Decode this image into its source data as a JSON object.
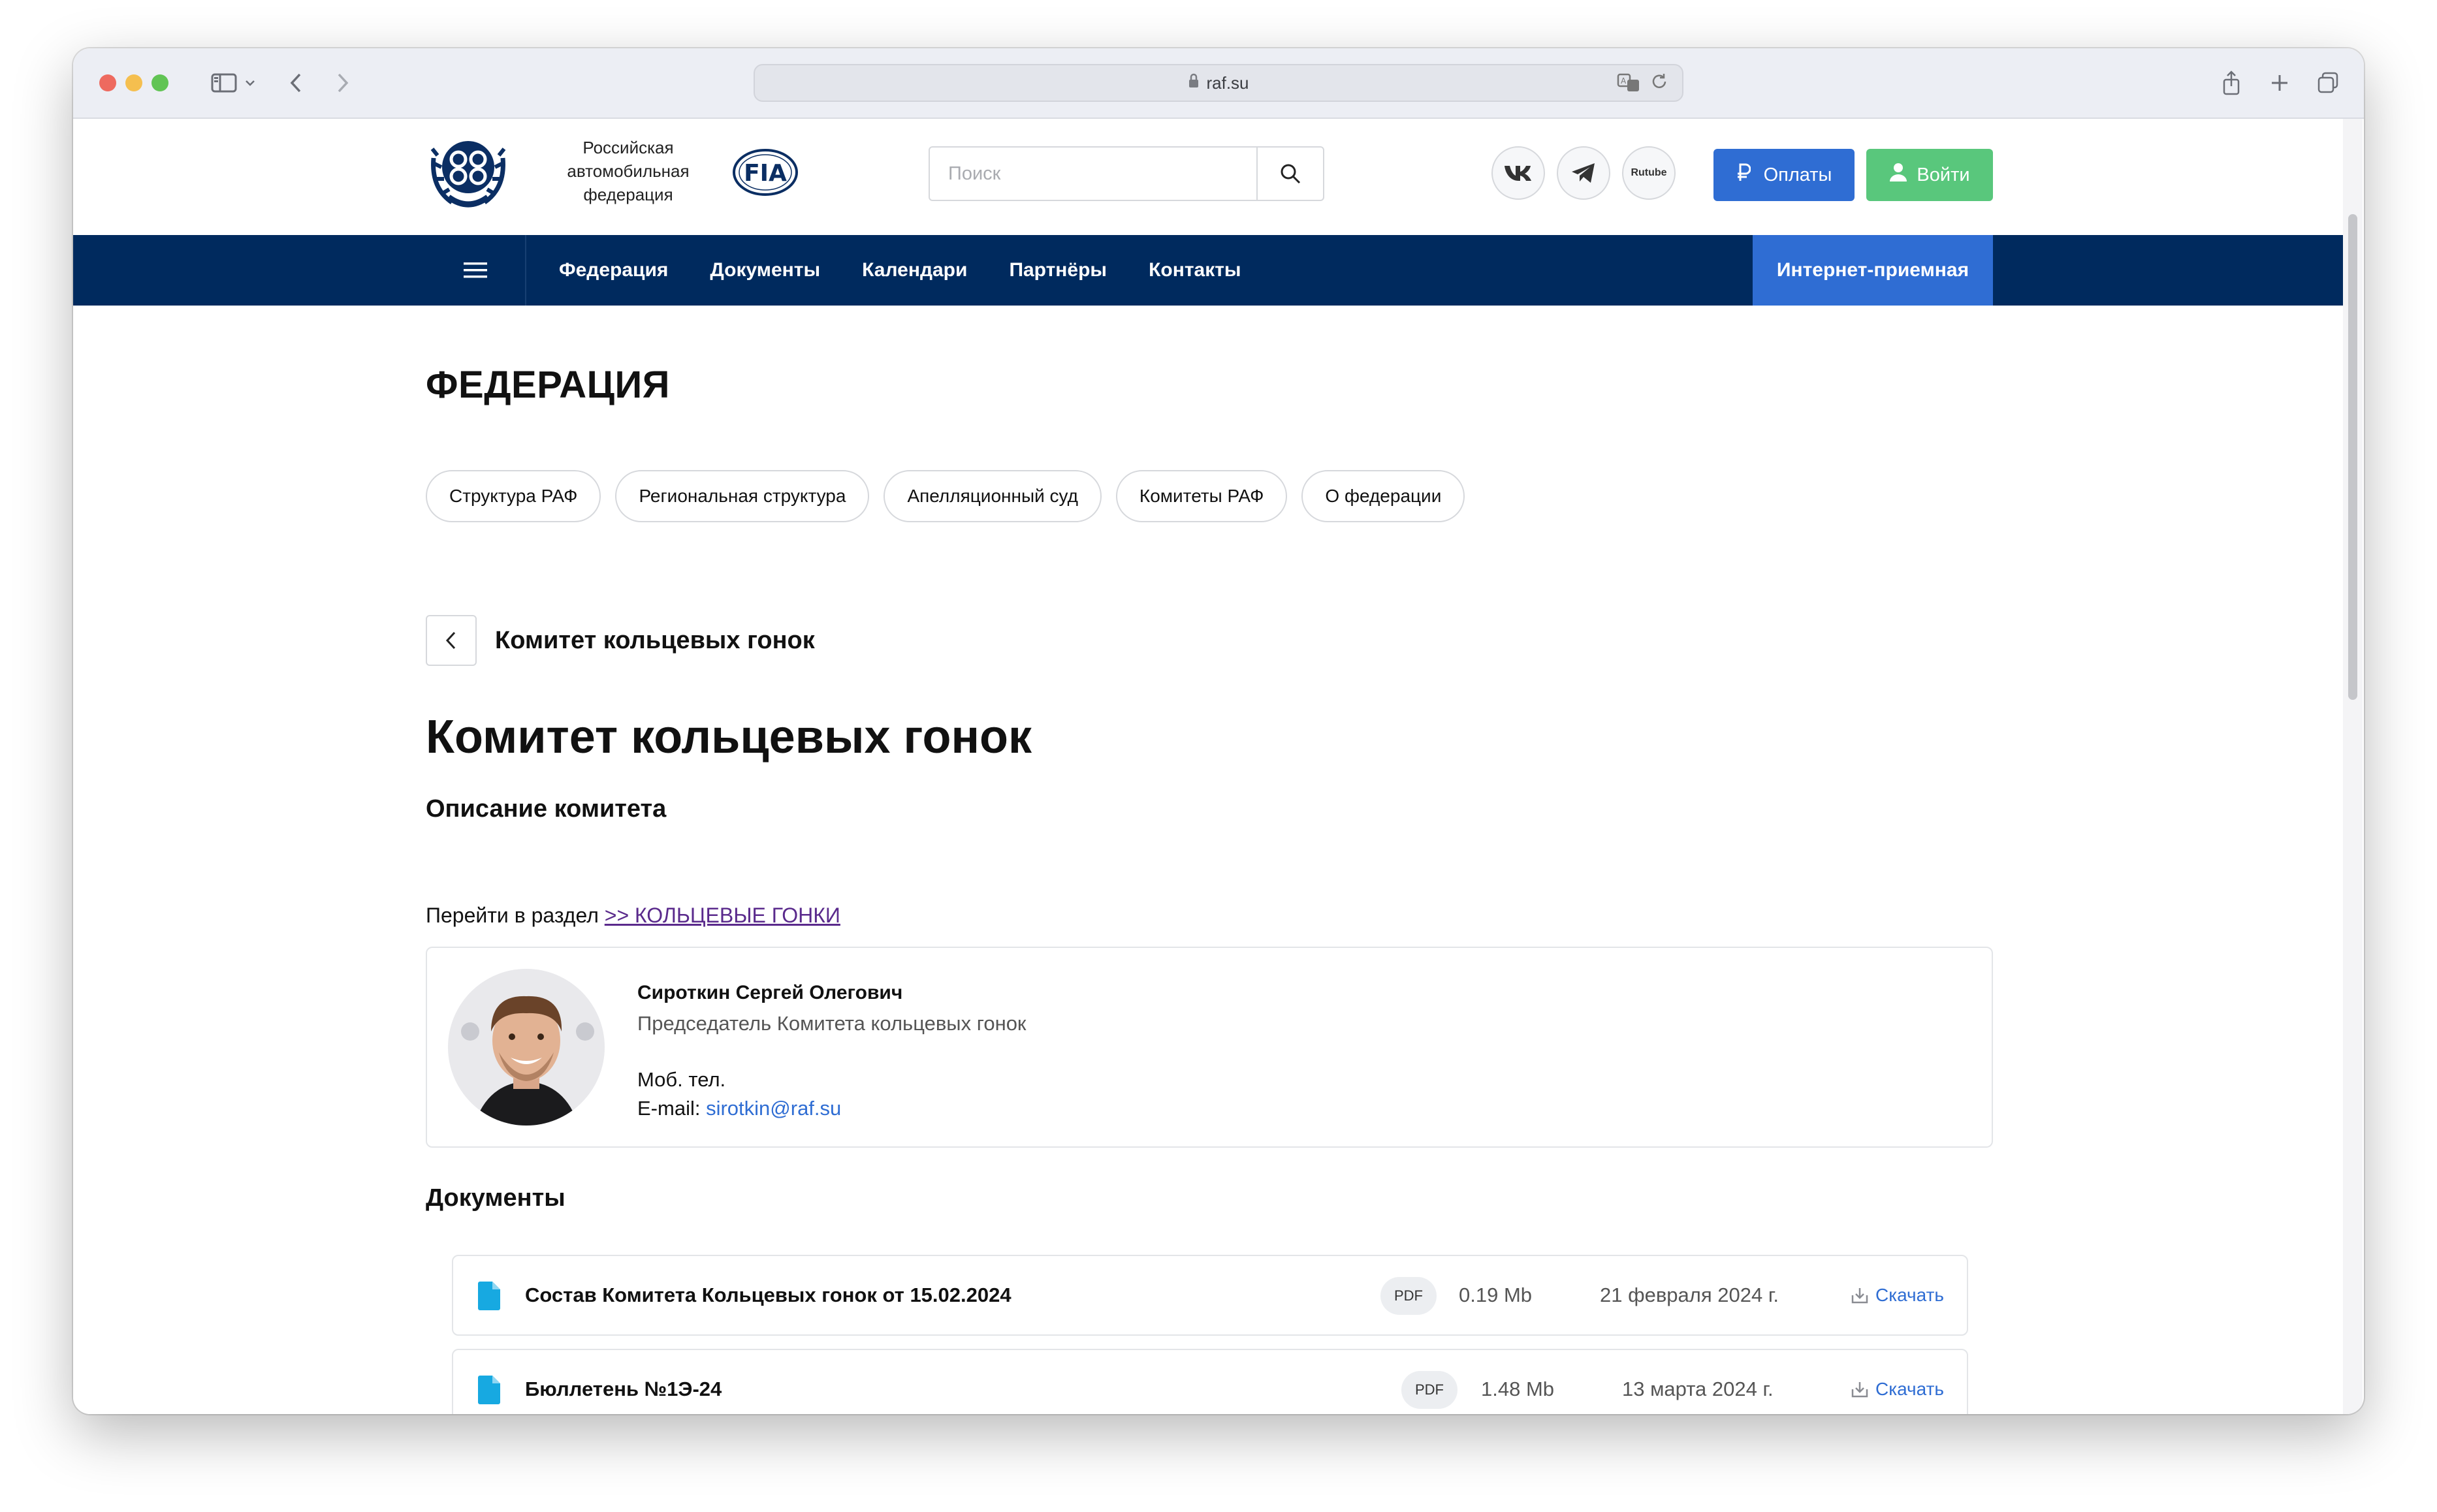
{
  "browser": {
    "url": "raf.su"
  },
  "header": {
    "logo_text": [
      "Российская",
      "автомобильная",
      "федерация"
    ],
    "fia_label": "FIA",
    "search_placeholder": "Поиск",
    "rutube_label": "Rutube",
    "pay_label": "Оплаты",
    "login_label": "Войти"
  },
  "nav": {
    "items": [
      "Федерация",
      "Документы",
      "Календари",
      "Партнёры",
      "Контакты"
    ],
    "cta": "Интернет-приемная"
  },
  "content": {
    "section_title": "ФЕДЕРАЦИЯ",
    "pills": [
      "Структура РАФ",
      "Региональная структура",
      "Апелляционный суд",
      "Комитеты РАФ",
      "О федерации"
    ],
    "back_title": "Комитет кольцевых гонок",
    "page_title": "Комитет кольцевых гонок",
    "desc_title": "Описание комитета",
    "goto_text": "Перейти в раздел",
    "goto_link": ">> КОЛЬЦЕВЫЕ ГОНКИ"
  },
  "person": {
    "name": "Сироткин Сергей Олегович",
    "role": "Председатель Комитета кольцевых гонок",
    "phone_label": "Моб. тел.",
    "email_label": "E-mail:",
    "email": "sirotkin@raf.su"
  },
  "documents": {
    "title": "Документы",
    "download_label": "Скачать",
    "items": [
      {
        "name": "Состав Комитета Кольцевых гонок от 15.02.2024",
        "type": "PDF",
        "size": "0.19 Mb",
        "date": "21 февраля 2024 г."
      },
      {
        "name": "Бюллетень №1Э-24",
        "type": "PDF",
        "size": "1.48 Mb",
        "date": "13 марта 2024 г."
      }
    ]
  },
  "colors": {
    "nav_bg": "#002a5e",
    "accent_blue": "#2f6dd3",
    "login_green": "#59c77c",
    "file_icon": "#17a9e1"
  }
}
